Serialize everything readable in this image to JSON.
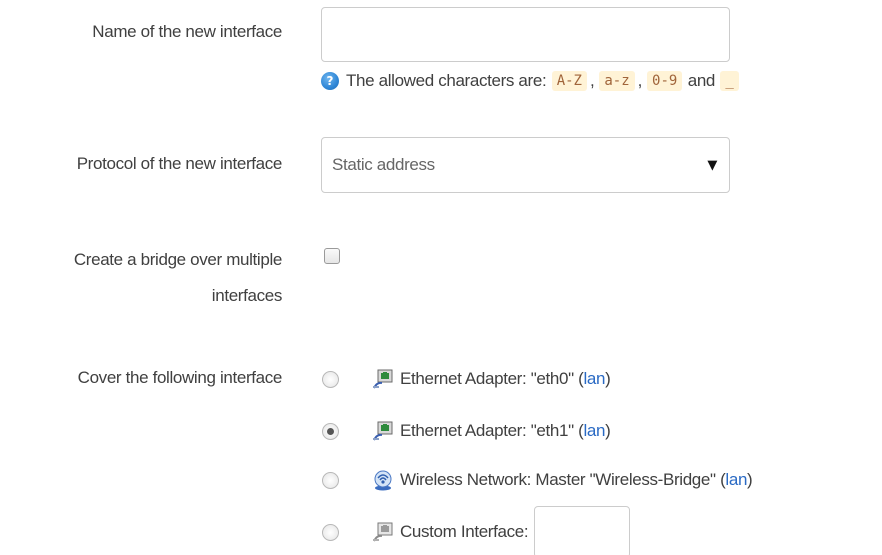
{
  "name_field": {
    "label": "Name of the new interface",
    "value": "",
    "hint_prefix": "The allowed characters are:",
    "allowed_1": "A-Z",
    "allowed_2": "a-z",
    "allowed_3": "0-9",
    "hint_and": "and",
    "allowed_4": "_",
    "separator": ","
  },
  "protocol_field": {
    "label": "Protocol of the new interface",
    "selected": "Static address"
  },
  "bridge_field": {
    "label_line1": "Create a bridge over multiple",
    "label_line2": "interfaces",
    "checked": false
  },
  "cover_field": {
    "label": "Cover the following interface",
    "options": [
      {
        "text": "Ethernet Adapter: \"eth0\"",
        "network": "lan",
        "icon": "ethernet-port-icon",
        "checked": false
      },
      {
        "text": "Ethernet Adapter: \"eth1\"",
        "network": "lan",
        "icon": "ethernet-port-icon",
        "checked": true
      },
      {
        "text": "Wireless Network: Master \"Wireless-Bridge\"",
        "network": "lan",
        "icon": "wireless-network-icon",
        "checked": false
      },
      {
        "text": "Custom Interface:",
        "network": "",
        "icon": "ethernet-port-icon",
        "checked": false
      }
    ],
    "paren_open": "(",
    "paren_close": ")"
  },
  "colors": {
    "link": "#2a6ac4",
    "code_bg": "#fff3d6",
    "code_text": "#a0643a",
    "label_text": "#404040"
  }
}
